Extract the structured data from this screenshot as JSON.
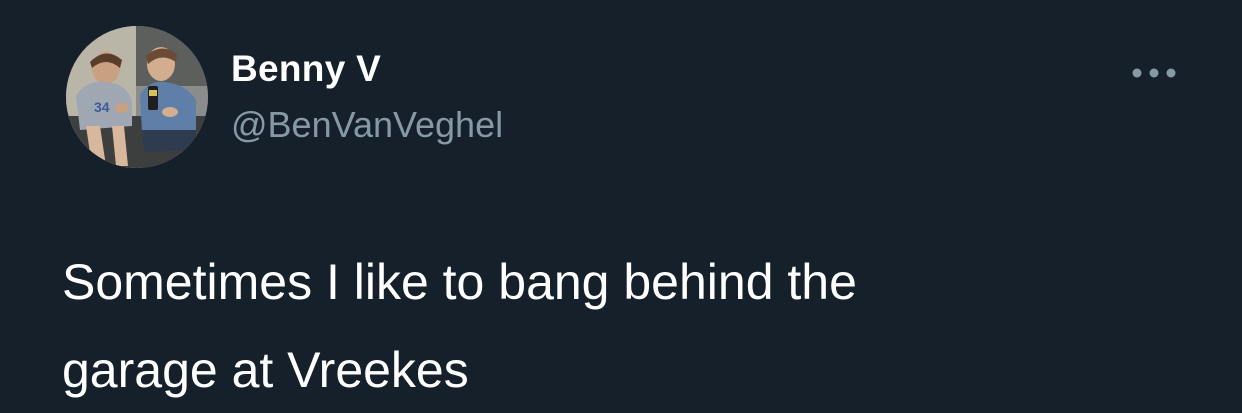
{
  "tweet": {
    "author": {
      "display_name": "Benny V",
      "handle": "@BenVanVeghel",
      "avatar": "profile-photo-two-people-sitting"
    },
    "text": "Sometimes I like to bang behind the\ngarage at Vreekes",
    "menu_icon": "more-horizontal-icon"
  },
  "colors": {
    "background": "#15202b",
    "primary_text": "#ffffff",
    "secondary_text": "#8899a6"
  }
}
